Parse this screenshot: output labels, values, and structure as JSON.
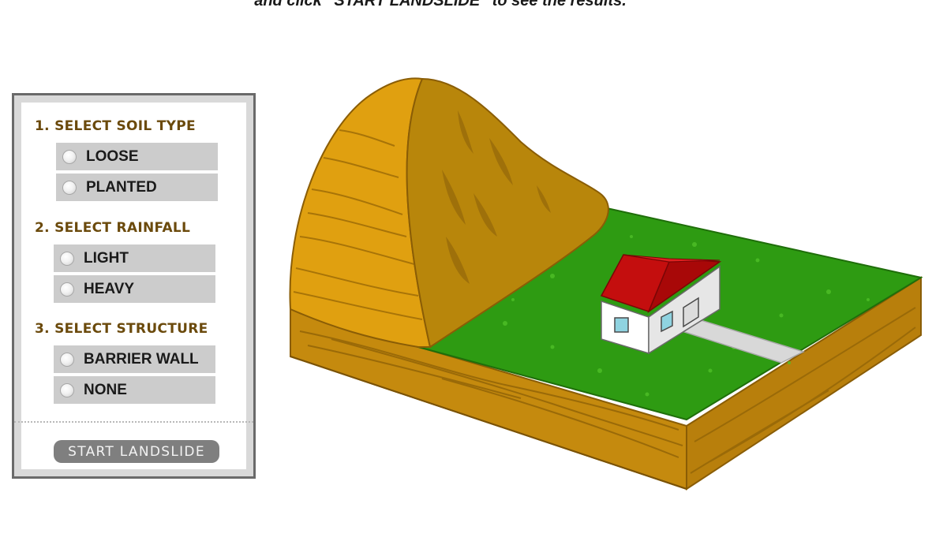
{
  "header": {
    "instruction": "and click “START LANDSLIDE” to see the results."
  },
  "panel": {
    "soil": {
      "title": "1. SELECT SOIL TYPE",
      "options": [
        "LOOSE",
        "PLANTED"
      ]
    },
    "rainfall": {
      "title": "2. SELECT RAINFALL",
      "options": [
        "LIGHT",
        "HEAVY"
      ]
    },
    "structure": {
      "title": "3. SELECT STRUCTURE",
      "options": [
        "BARRIER WALL",
        "NONE"
      ]
    },
    "start_label": "START LANDSLIDE"
  },
  "colors": {
    "title_brown": "#6b4a0c",
    "option_bg": "#cccccc",
    "button_bg": "#7f7f7f",
    "soil": "#c8900f",
    "grass": "#2e9b12",
    "roof": "#d01010"
  }
}
